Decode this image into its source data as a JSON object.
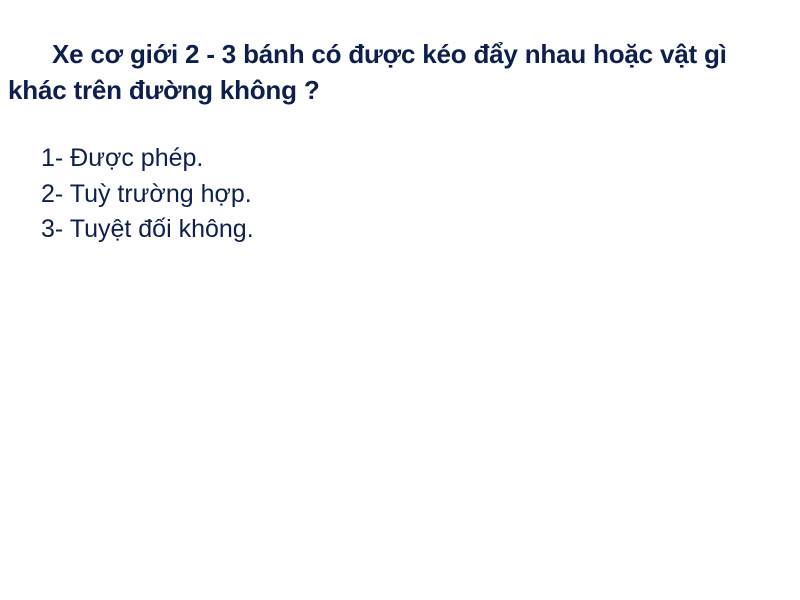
{
  "question": "Xe cơ giới 2 - 3 bánh có được kéo đẩy nhau hoặc vật gì khác trên đường không ?",
  "answers": [
    "1- Được phép.",
    "2- Tuỳ trường hợp.",
    "3- Tuyệt đối không."
  ],
  "colors": {
    "text": "#0f1f4d",
    "background": "#ffffff"
  }
}
